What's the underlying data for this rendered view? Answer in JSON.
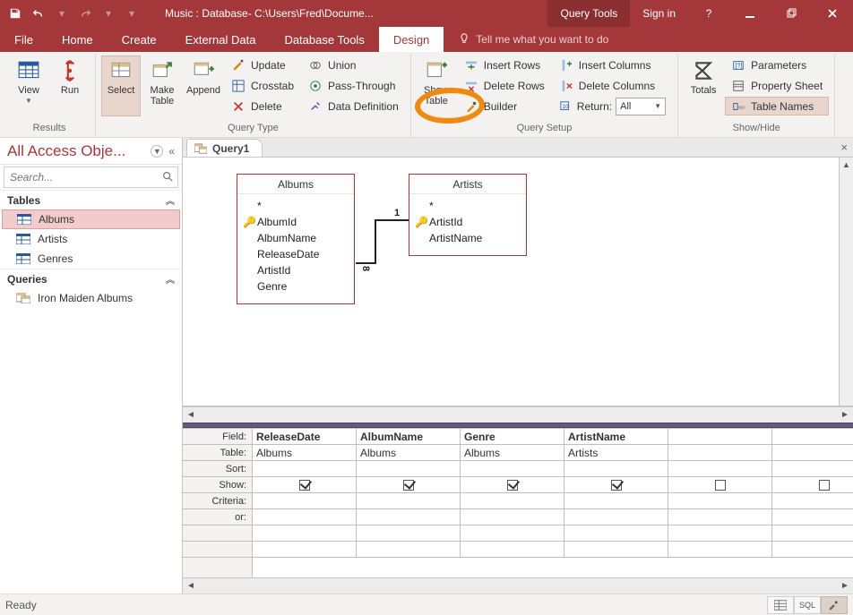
{
  "titlebar": {
    "title": "Music : Database- C:\\Users\\Fred\\Docume...",
    "context_tab": "Query Tools",
    "signin": "Sign in"
  },
  "tabs": {
    "items": [
      "File",
      "Home",
      "Create",
      "External Data",
      "Database Tools",
      "Design"
    ],
    "active_index": 5,
    "tellme": "Tell me what you want to do"
  },
  "ribbon": {
    "group_results": {
      "label": "Results",
      "view": "View",
      "run": "Run"
    },
    "group_querytype": {
      "label": "Query Type",
      "select": "Select",
      "maketable": "Make\nTable",
      "append": "Append",
      "update": "Update",
      "crosstab": "Crosstab",
      "delete": "Delete",
      "union": "Union",
      "passthrough": "Pass-Through",
      "datadef": "Data Definition"
    },
    "group_querysetup": {
      "label": "Query Setup",
      "showtable": "Show\nTable",
      "insertrows": "Insert Rows",
      "deleterows": "Delete Rows",
      "builder": "Builder",
      "insertcols": "Insert Columns",
      "deletecols": "Delete Columns",
      "return_lbl": "Return:",
      "return_val": "All"
    },
    "group_showhide": {
      "label": "Show/Hide",
      "totals": "Totals",
      "parameters": "Parameters",
      "propsheet": "Property Sheet",
      "tablenames": "Table Names"
    }
  },
  "navpane": {
    "header": "All Access Obje...",
    "search_ph": "Search...",
    "group_tables": "Tables",
    "group_queries": "Queries",
    "tables": [
      "Albums",
      "Artists",
      "Genres"
    ],
    "queries": [
      "Iron Maiden Albums"
    ]
  },
  "doc": {
    "tab_label": "Query1"
  },
  "design": {
    "tables": {
      "albums": {
        "title": "Albums",
        "star": "*",
        "fields": [
          "AlbumId",
          "AlbumName",
          "ReleaseDate",
          "ArtistId",
          "Genre"
        ],
        "pk_index": 0
      },
      "artists": {
        "title": "Artists",
        "star": "*",
        "fields": [
          "ArtistId",
          "ArtistName"
        ],
        "pk_index": 0
      }
    },
    "rel": {
      "one": "1",
      "many": "∞",
      "many_glyph": "8"
    }
  },
  "qbe": {
    "labels": [
      "Field:",
      "Table:",
      "Sort:",
      "Show:",
      "Criteria:",
      "or:",
      "",
      ""
    ],
    "cols": [
      {
        "field": "ReleaseDate",
        "table": "Albums",
        "show": true
      },
      {
        "field": "AlbumName",
        "table": "Albums",
        "show": true
      },
      {
        "field": "Genre",
        "table": "Albums",
        "show": true
      },
      {
        "field": "ArtistName",
        "table": "Artists",
        "show": true
      },
      {
        "field": "",
        "table": "",
        "show": false
      },
      {
        "field": "",
        "table": "",
        "show": false
      }
    ]
  },
  "status": {
    "ready": "Ready",
    "sql": "SQL"
  }
}
